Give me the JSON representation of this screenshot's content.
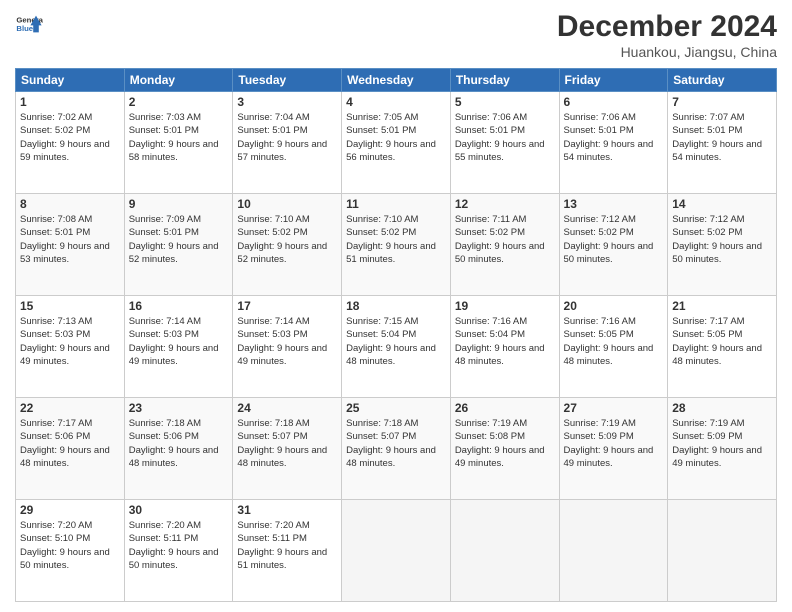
{
  "header": {
    "logo_line1": "General",
    "logo_line2": "Blue",
    "month": "December 2024",
    "location": "Huankou, Jiangsu, China"
  },
  "weekdays": [
    "Sunday",
    "Monday",
    "Tuesday",
    "Wednesday",
    "Thursday",
    "Friday",
    "Saturday"
  ],
  "weeks": [
    [
      {
        "day": 1,
        "sunrise": "7:02 AM",
        "sunset": "5:02 PM",
        "daylight": "9 hours and 59 minutes."
      },
      {
        "day": 2,
        "sunrise": "7:03 AM",
        "sunset": "5:01 PM",
        "daylight": "9 hours and 58 minutes."
      },
      {
        "day": 3,
        "sunrise": "7:04 AM",
        "sunset": "5:01 PM",
        "daylight": "9 hours and 57 minutes."
      },
      {
        "day": 4,
        "sunrise": "7:05 AM",
        "sunset": "5:01 PM",
        "daylight": "9 hours and 56 minutes."
      },
      {
        "day": 5,
        "sunrise": "7:06 AM",
        "sunset": "5:01 PM",
        "daylight": "9 hours and 55 minutes."
      },
      {
        "day": 6,
        "sunrise": "7:06 AM",
        "sunset": "5:01 PM",
        "daylight": "9 hours and 54 minutes."
      },
      {
        "day": 7,
        "sunrise": "7:07 AM",
        "sunset": "5:01 PM",
        "daylight": "9 hours and 54 minutes."
      }
    ],
    [
      {
        "day": 8,
        "sunrise": "7:08 AM",
        "sunset": "5:01 PM",
        "daylight": "9 hours and 53 minutes."
      },
      {
        "day": 9,
        "sunrise": "7:09 AM",
        "sunset": "5:01 PM",
        "daylight": "9 hours and 52 minutes."
      },
      {
        "day": 10,
        "sunrise": "7:10 AM",
        "sunset": "5:02 PM",
        "daylight": "9 hours and 52 minutes."
      },
      {
        "day": 11,
        "sunrise": "7:10 AM",
        "sunset": "5:02 PM",
        "daylight": "9 hours and 51 minutes."
      },
      {
        "day": 12,
        "sunrise": "7:11 AM",
        "sunset": "5:02 PM",
        "daylight": "9 hours and 50 minutes."
      },
      {
        "day": 13,
        "sunrise": "7:12 AM",
        "sunset": "5:02 PM",
        "daylight": "9 hours and 50 minutes."
      },
      {
        "day": 14,
        "sunrise": "7:12 AM",
        "sunset": "5:02 PM",
        "daylight": "9 hours and 50 minutes."
      }
    ],
    [
      {
        "day": 15,
        "sunrise": "7:13 AM",
        "sunset": "5:03 PM",
        "daylight": "9 hours and 49 minutes."
      },
      {
        "day": 16,
        "sunrise": "7:14 AM",
        "sunset": "5:03 PM",
        "daylight": "9 hours and 49 minutes."
      },
      {
        "day": 17,
        "sunrise": "7:14 AM",
        "sunset": "5:03 PM",
        "daylight": "9 hours and 49 minutes."
      },
      {
        "day": 18,
        "sunrise": "7:15 AM",
        "sunset": "5:04 PM",
        "daylight": "9 hours and 48 minutes."
      },
      {
        "day": 19,
        "sunrise": "7:16 AM",
        "sunset": "5:04 PM",
        "daylight": "9 hours and 48 minutes."
      },
      {
        "day": 20,
        "sunrise": "7:16 AM",
        "sunset": "5:05 PM",
        "daylight": "9 hours and 48 minutes."
      },
      {
        "day": 21,
        "sunrise": "7:17 AM",
        "sunset": "5:05 PM",
        "daylight": "9 hours and 48 minutes."
      }
    ],
    [
      {
        "day": 22,
        "sunrise": "7:17 AM",
        "sunset": "5:06 PM",
        "daylight": "9 hours and 48 minutes."
      },
      {
        "day": 23,
        "sunrise": "7:18 AM",
        "sunset": "5:06 PM",
        "daylight": "9 hours and 48 minutes."
      },
      {
        "day": 24,
        "sunrise": "7:18 AM",
        "sunset": "5:07 PM",
        "daylight": "9 hours and 48 minutes."
      },
      {
        "day": 25,
        "sunrise": "7:18 AM",
        "sunset": "5:07 PM",
        "daylight": "9 hours and 48 minutes."
      },
      {
        "day": 26,
        "sunrise": "7:19 AM",
        "sunset": "5:08 PM",
        "daylight": "9 hours and 49 minutes."
      },
      {
        "day": 27,
        "sunrise": "7:19 AM",
        "sunset": "5:09 PM",
        "daylight": "9 hours and 49 minutes."
      },
      {
        "day": 28,
        "sunrise": "7:19 AM",
        "sunset": "5:09 PM",
        "daylight": "9 hours and 49 minutes."
      }
    ],
    [
      {
        "day": 29,
        "sunrise": "7:20 AM",
        "sunset": "5:10 PM",
        "daylight": "9 hours and 50 minutes."
      },
      {
        "day": 30,
        "sunrise": "7:20 AM",
        "sunset": "5:11 PM",
        "daylight": "9 hours and 50 minutes."
      },
      {
        "day": 31,
        "sunrise": "7:20 AM",
        "sunset": "5:11 PM",
        "daylight": "9 hours and 51 minutes."
      },
      null,
      null,
      null,
      null
    ]
  ]
}
